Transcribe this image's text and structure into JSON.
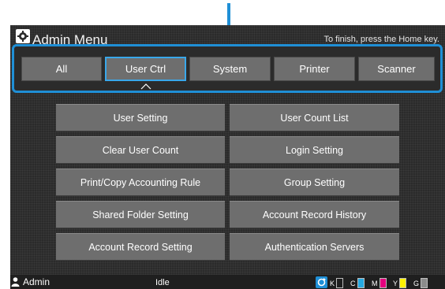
{
  "header": {
    "title": "Admin Menu",
    "hint": "To finish, press the Home key."
  },
  "tabs": [
    {
      "label": "All",
      "selected": false
    },
    {
      "label": "User Ctrl",
      "selected": true
    },
    {
      "label": "System",
      "selected": false
    },
    {
      "label": "Printer",
      "selected": false
    },
    {
      "label": "Scanner",
      "selected": false
    }
  ],
  "menu": [
    {
      "label": "User Setting"
    },
    {
      "label": "User Count List"
    },
    {
      "label": "Clear User Count"
    },
    {
      "label": "Login Setting"
    },
    {
      "label": "Print/Copy Accounting Rule"
    },
    {
      "label": "Group Setting"
    },
    {
      "label": "Shared Folder Setting"
    },
    {
      "label": "Account Record History"
    },
    {
      "label": "Account Record Setting"
    },
    {
      "label": "Authentication Servers"
    }
  ],
  "status": {
    "user": "Admin",
    "state": "Idle"
  },
  "toner": [
    {
      "label": "K",
      "color": "#111111",
      "level": 0.0
    },
    {
      "label": "C",
      "color": "#27a9e1",
      "level": 1.0
    },
    {
      "label": "M",
      "color": "#e6007e",
      "level": 1.0
    },
    {
      "label": "Y",
      "color": "#fff200",
      "level": 1.0
    },
    {
      "label": "G",
      "color": "#8c8c8c",
      "level": 1.0
    }
  ],
  "colors": {
    "accent": "#1f8fd6",
    "selected_tab_border": "#39a7ea",
    "button": "#6e6e6e",
    "background": "#2b2b2b"
  }
}
